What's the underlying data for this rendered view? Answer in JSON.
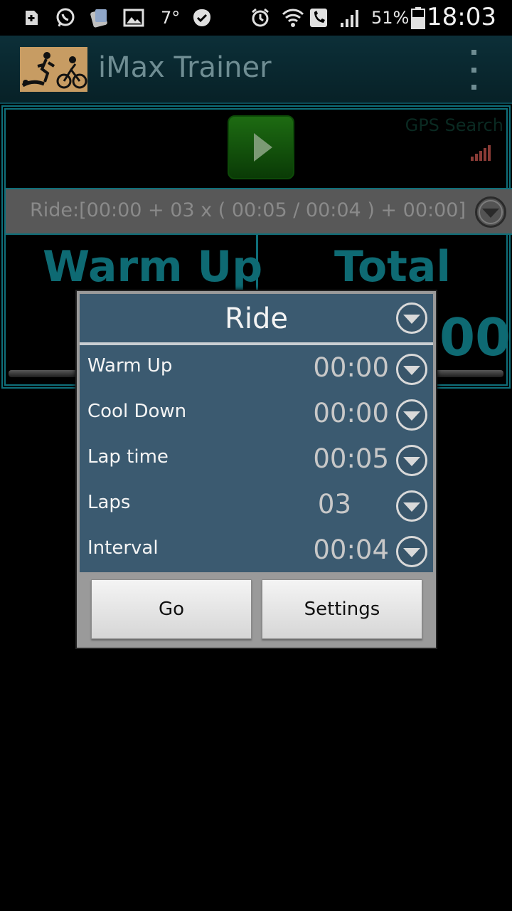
{
  "status_bar": {
    "temperature": "7°",
    "battery": "51%",
    "time": "18:03",
    "icons": [
      "add-notification-icon",
      "whatsapp-icon",
      "app-icon",
      "image-icon",
      "check-badge-icon",
      "alarm-icon",
      "wifi-icon",
      "call-icon",
      "signal-icon",
      "battery-icon"
    ]
  },
  "app_bar": {
    "title": "iMax Trainer",
    "menu_icon": "overflow-menu-icon"
  },
  "panel": {
    "gps_text": "GPS Search",
    "summary": "Ride:[00:00 + 03 x ( 00:05 / 00:04 ) + 00:00]",
    "left_label": "Warm Up",
    "right_label": "Total",
    "right_value": "00"
  },
  "dialog": {
    "title": "Ride",
    "rows": [
      {
        "label": "Warm Up",
        "value": "00:00"
      },
      {
        "label": "Cool Down",
        "value": "00:00"
      },
      {
        "label": "Lap time",
        "value": "00:05"
      },
      {
        "label": "Laps",
        "value": "03"
      },
      {
        "label": "Interval",
        "value": "00:04"
      }
    ],
    "go_label": "Go",
    "settings_label": "Settings"
  },
  "colors": {
    "teal_accent": "#0e6a73",
    "dialog_bg": "#3b5a70",
    "play_green": "#1d6b12"
  }
}
